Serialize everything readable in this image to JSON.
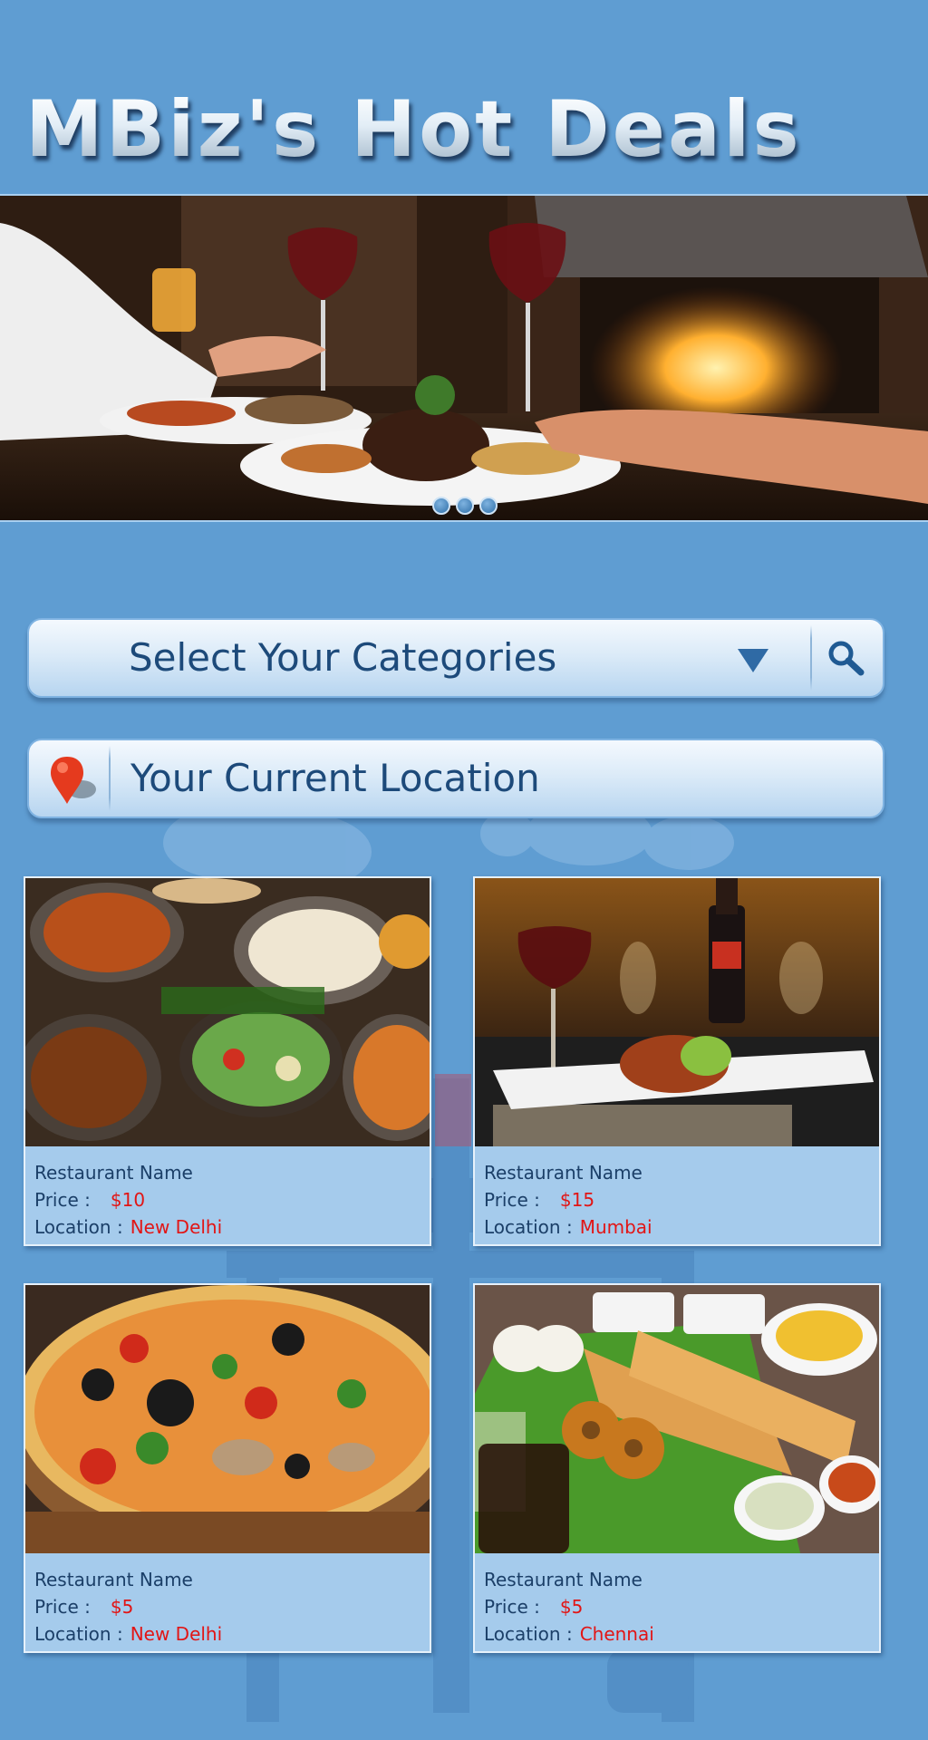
{
  "header": {
    "title": "MBiz's Hot Deals"
  },
  "hero": {
    "slides": 3,
    "active_slide": 1
  },
  "category_select": {
    "label": "Select Your Categories"
  },
  "location": {
    "label": "Your Current Location"
  },
  "cards": [
    {
      "name": "Restaurant Name",
      "price_label": "Price :",
      "price": "$10",
      "location_label": "Location :",
      "location": "New Delhi"
    },
    {
      "name": "Restaurant Name",
      "price_label": "Price :",
      "price": "$15",
      "location_label": "Location :",
      "location": "Mumbai"
    },
    {
      "name": "Restaurant Name",
      "price_label": "Price :",
      "price": "$5",
      "location_label": "Location :",
      "location": "New Delhi"
    },
    {
      "name": "Restaurant Name",
      "price_label": "Price :",
      "price": "$5",
      "location_label": "Location :",
      "location": "Chennai"
    }
  ],
  "colors": {
    "background": "#5f9dd2",
    "bar_text": "#1d4a7a",
    "card_bg": "#a5cbec",
    "price_red": "#e21515",
    "pin_red": "#e53a1e"
  },
  "icons": [
    "map-pin-icon",
    "search-icon",
    "dropdown-arrow-icon"
  ]
}
